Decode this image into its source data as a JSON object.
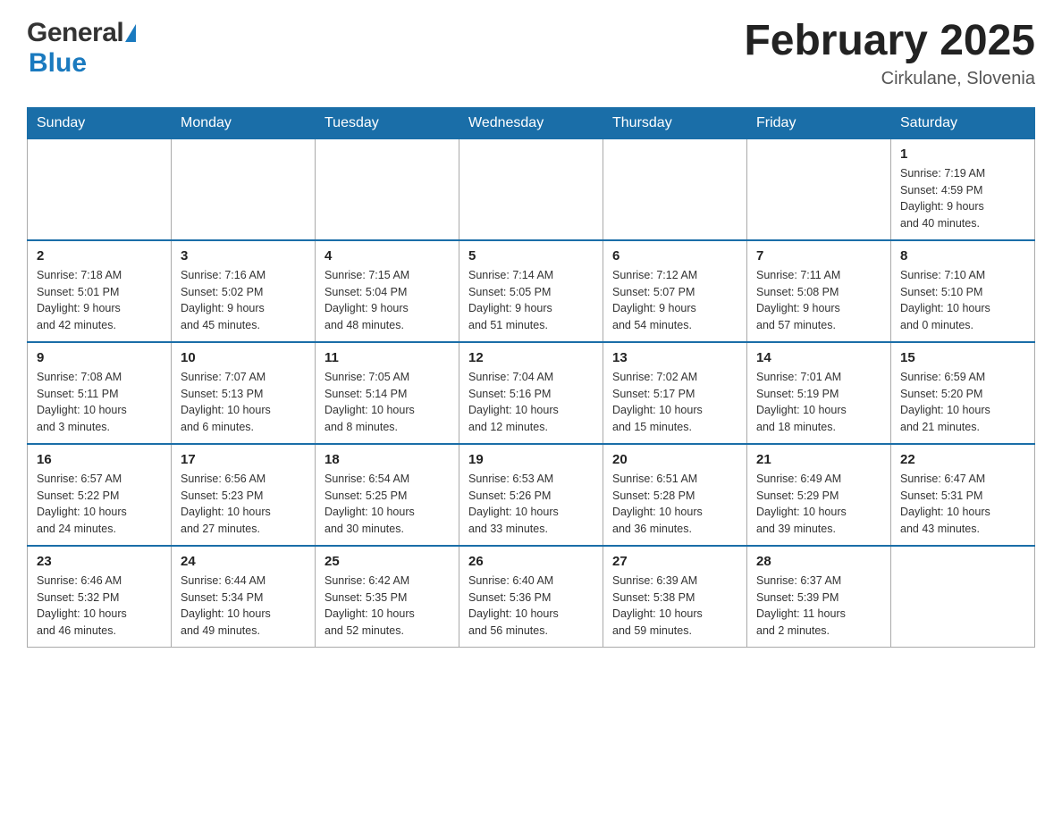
{
  "header": {
    "logo_general": "General",
    "logo_blue": "Blue",
    "title": "February 2025",
    "subtitle": "Cirkulane, Slovenia"
  },
  "days_of_week": [
    "Sunday",
    "Monday",
    "Tuesday",
    "Wednesday",
    "Thursday",
    "Friday",
    "Saturday"
  ],
  "weeks": [
    {
      "days": [
        {
          "number": "",
          "info": ""
        },
        {
          "number": "",
          "info": ""
        },
        {
          "number": "",
          "info": ""
        },
        {
          "number": "",
          "info": ""
        },
        {
          "number": "",
          "info": ""
        },
        {
          "number": "",
          "info": ""
        },
        {
          "number": "1",
          "info": "Sunrise: 7:19 AM\nSunset: 4:59 PM\nDaylight: 9 hours\nand 40 minutes."
        }
      ]
    },
    {
      "days": [
        {
          "number": "2",
          "info": "Sunrise: 7:18 AM\nSunset: 5:01 PM\nDaylight: 9 hours\nand 42 minutes."
        },
        {
          "number": "3",
          "info": "Sunrise: 7:16 AM\nSunset: 5:02 PM\nDaylight: 9 hours\nand 45 minutes."
        },
        {
          "number": "4",
          "info": "Sunrise: 7:15 AM\nSunset: 5:04 PM\nDaylight: 9 hours\nand 48 minutes."
        },
        {
          "number": "5",
          "info": "Sunrise: 7:14 AM\nSunset: 5:05 PM\nDaylight: 9 hours\nand 51 minutes."
        },
        {
          "number": "6",
          "info": "Sunrise: 7:12 AM\nSunset: 5:07 PM\nDaylight: 9 hours\nand 54 minutes."
        },
        {
          "number": "7",
          "info": "Sunrise: 7:11 AM\nSunset: 5:08 PM\nDaylight: 9 hours\nand 57 minutes."
        },
        {
          "number": "8",
          "info": "Sunrise: 7:10 AM\nSunset: 5:10 PM\nDaylight: 10 hours\nand 0 minutes."
        }
      ]
    },
    {
      "days": [
        {
          "number": "9",
          "info": "Sunrise: 7:08 AM\nSunset: 5:11 PM\nDaylight: 10 hours\nand 3 minutes."
        },
        {
          "number": "10",
          "info": "Sunrise: 7:07 AM\nSunset: 5:13 PM\nDaylight: 10 hours\nand 6 minutes."
        },
        {
          "number": "11",
          "info": "Sunrise: 7:05 AM\nSunset: 5:14 PM\nDaylight: 10 hours\nand 8 minutes."
        },
        {
          "number": "12",
          "info": "Sunrise: 7:04 AM\nSunset: 5:16 PM\nDaylight: 10 hours\nand 12 minutes."
        },
        {
          "number": "13",
          "info": "Sunrise: 7:02 AM\nSunset: 5:17 PM\nDaylight: 10 hours\nand 15 minutes."
        },
        {
          "number": "14",
          "info": "Sunrise: 7:01 AM\nSunset: 5:19 PM\nDaylight: 10 hours\nand 18 minutes."
        },
        {
          "number": "15",
          "info": "Sunrise: 6:59 AM\nSunset: 5:20 PM\nDaylight: 10 hours\nand 21 minutes."
        }
      ]
    },
    {
      "days": [
        {
          "number": "16",
          "info": "Sunrise: 6:57 AM\nSunset: 5:22 PM\nDaylight: 10 hours\nand 24 minutes."
        },
        {
          "number": "17",
          "info": "Sunrise: 6:56 AM\nSunset: 5:23 PM\nDaylight: 10 hours\nand 27 minutes."
        },
        {
          "number": "18",
          "info": "Sunrise: 6:54 AM\nSunset: 5:25 PM\nDaylight: 10 hours\nand 30 minutes."
        },
        {
          "number": "19",
          "info": "Sunrise: 6:53 AM\nSunset: 5:26 PM\nDaylight: 10 hours\nand 33 minutes."
        },
        {
          "number": "20",
          "info": "Sunrise: 6:51 AM\nSunset: 5:28 PM\nDaylight: 10 hours\nand 36 minutes."
        },
        {
          "number": "21",
          "info": "Sunrise: 6:49 AM\nSunset: 5:29 PM\nDaylight: 10 hours\nand 39 minutes."
        },
        {
          "number": "22",
          "info": "Sunrise: 6:47 AM\nSunset: 5:31 PM\nDaylight: 10 hours\nand 43 minutes."
        }
      ]
    },
    {
      "days": [
        {
          "number": "23",
          "info": "Sunrise: 6:46 AM\nSunset: 5:32 PM\nDaylight: 10 hours\nand 46 minutes."
        },
        {
          "number": "24",
          "info": "Sunrise: 6:44 AM\nSunset: 5:34 PM\nDaylight: 10 hours\nand 49 minutes."
        },
        {
          "number": "25",
          "info": "Sunrise: 6:42 AM\nSunset: 5:35 PM\nDaylight: 10 hours\nand 52 minutes."
        },
        {
          "number": "26",
          "info": "Sunrise: 6:40 AM\nSunset: 5:36 PM\nDaylight: 10 hours\nand 56 minutes."
        },
        {
          "number": "27",
          "info": "Sunrise: 6:39 AM\nSunset: 5:38 PM\nDaylight: 10 hours\nand 59 minutes."
        },
        {
          "number": "28",
          "info": "Sunrise: 6:37 AM\nSunset: 5:39 PM\nDaylight: 11 hours\nand 2 minutes."
        },
        {
          "number": "",
          "info": ""
        }
      ]
    }
  ]
}
